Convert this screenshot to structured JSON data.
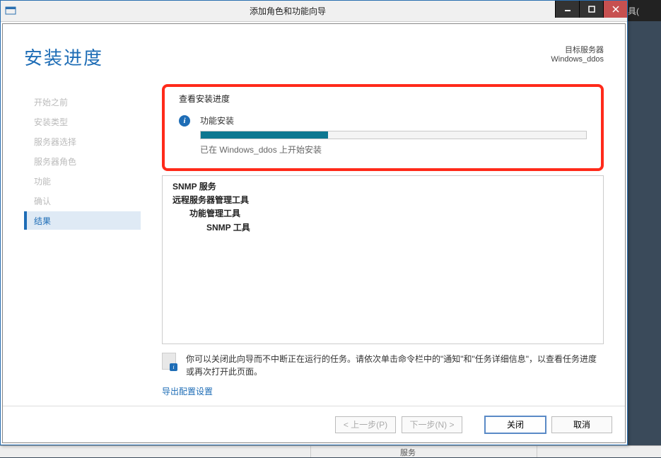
{
  "bg": {
    "menu_fragment": "工具(",
    "col1": "",
    "col2": "服务"
  },
  "titlebar": {
    "title": "添加角色和功能向导"
  },
  "header": {
    "page_title": "安装进度",
    "target_label": "目标服务器",
    "target_server": "Windows_ddos"
  },
  "sidebar": {
    "items": [
      {
        "label": "开始之前",
        "active": false
      },
      {
        "label": "安装类型",
        "active": false
      },
      {
        "label": "服务器选择",
        "active": false
      },
      {
        "label": "服务器角色",
        "active": false
      },
      {
        "label": "功能",
        "active": false
      },
      {
        "label": "确认",
        "active": false
      },
      {
        "label": "结果",
        "active": true
      }
    ]
  },
  "progress": {
    "section_label": "查看安装进度",
    "status_title": "功能安装",
    "percent": 33,
    "status_text": "已在 Windows_ddos 上开始安装"
  },
  "features": {
    "lines": [
      {
        "text": "SNMP 服务",
        "bold": true,
        "indent": 0
      },
      {
        "text": "远程服务器管理工具",
        "bold": true,
        "indent": 0
      },
      {
        "text": "功能管理工具",
        "bold": true,
        "indent": 1
      },
      {
        "text": "SNMP 工具",
        "bold": true,
        "indent": 2
      }
    ]
  },
  "note": {
    "text": "你可以关闭此向导而不中断正在运行的任务。请依次单击命令栏中的\"通知\"和\"任务详细信息\"，以查看任务进度或再次打开此页面。"
  },
  "link": {
    "export_label": "导出配置设置"
  },
  "buttons": {
    "prev": "< 上一步(P)",
    "next": "下一步(N) >",
    "close": "关闭",
    "cancel": "取消"
  }
}
